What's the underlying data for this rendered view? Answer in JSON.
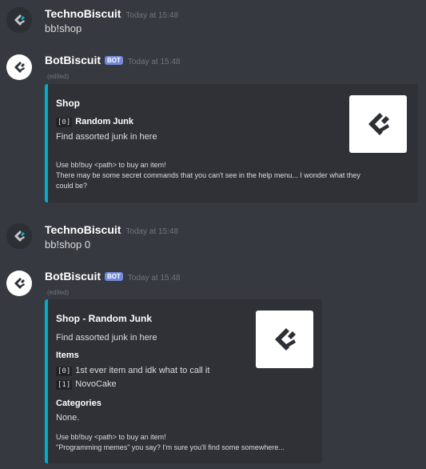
{
  "messages": [
    {
      "username": "TechnoBiscuit",
      "timestamp": "Today at 15:48",
      "content": "bb!shop"
    },
    {
      "username": "BotBiscuit",
      "bot_tag": "BOT",
      "timestamp": "Today at 15:48",
      "edited": "(edited)",
      "embed": {
        "title": "Shop",
        "item_code": "[0]",
        "item_name": "Random Junk",
        "description": "Find assorted junk in here",
        "footer_line1": "Use bb!buy <path> to buy an item!",
        "footer_line2": "There may be some secret commands that you can't see in the help menu... I wonder what they",
        "footer_line3": "could be?"
      }
    },
    {
      "username": "TechnoBiscuit",
      "timestamp": "Today at 15:48",
      "content": "bb!shop 0"
    },
    {
      "username": "BotBiscuit",
      "bot_tag": "BOT",
      "timestamp": "Today at 15:48",
      "edited": "(edited)",
      "embed": {
        "title": "Shop - Random Junk",
        "description": "Find assorted junk in here",
        "items_header": "Items",
        "items": [
          {
            "code": "[0]",
            "name": "1st ever item and idk what to call it"
          },
          {
            "code": "[1]",
            "name": "NovoCake"
          }
        ],
        "categories_header": "Categories",
        "categories_value": "None.",
        "footer_line1": "Use bb!buy <path> to buy an item!",
        "footer_line2": "\"Programming memes\" you say? I'm sure you'll find some somewhere..."
      }
    }
  ],
  "colors": {
    "background": "#36393f",
    "embed_bg": "#2f3136",
    "embed_accent": "#00aec8",
    "bot_tag": "#7289da",
    "username": "#ffffff",
    "timestamp": "#72767d"
  },
  "icons": {
    "avatar_user": "biscuit-logo-icon",
    "avatar_bot": "biscuit-logo-icon",
    "embed_thumbnail": "biscuit-logo-icon"
  }
}
